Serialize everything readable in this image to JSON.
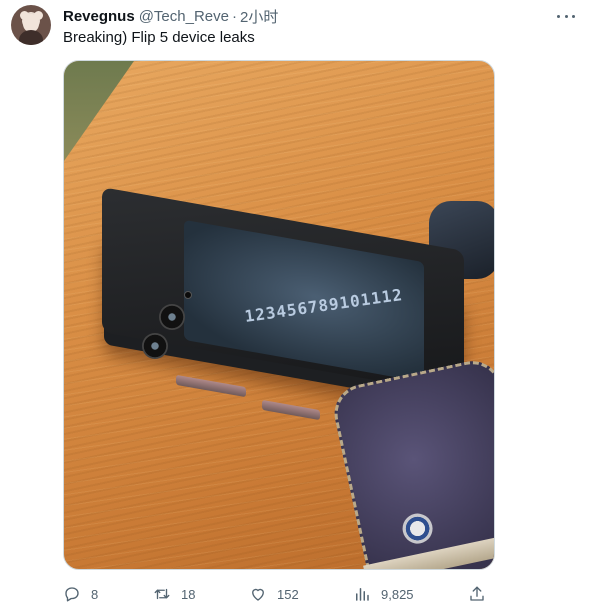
{
  "tweet": {
    "author": {
      "name": "Revegnus",
      "handle": "@Tech_Reve",
      "separator": "·",
      "time": "2小时"
    },
    "more_icon": "more-horizontal-icon",
    "text": "Breaking) Flip 5 device leaks",
    "media": {
      "kind": "photo",
      "watch_face_text": "123456789101112"
    },
    "actions": {
      "reply": {
        "icon": "reply-icon",
        "count": "8"
      },
      "retweet": {
        "icon": "retweet-icon",
        "count": "18"
      },
      "like": {
        "icon": "heart-icon",
        "count": "152"
      },
      "views": {
        "icon": "views-chart-icon",
        "count": "9,825"
      },
      "share": {
        "icon": "share-icon"
      }
    }
  }
}
